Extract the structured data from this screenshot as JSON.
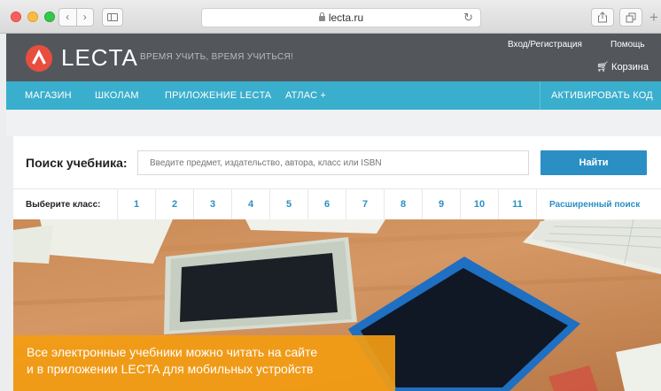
{
  "browser": {
    "url": "lecta.ru",
    "icons": [
      "back-icon",
      "forward-icon",
      "sidebar-icon",
      "lock-icon",
      "reload-icon",
      "share-icon",
      "tabs-icon",
      "new-tab-icon"
    ]
  },
  "header": {
    "logo_text": "LECTA",
    "slogan": "ВРЕМЯ УЧИТЬ, ВРЕМЯ УЧИТЬСЯ!",
    "login": "Вход/Регистрация",
    "help": "Помощь",
    "cart": "Корзина",
    "colors": {
      "header_bg": "#53575c",
      "logo_red": "#e84e3e"
    }
  },
  "nav": {
    "items": [
      "МАГАЗИН",
      "ШКОЛАМ",
      "ПРИЛОЖЕНИЕ LECTA",
      "АТЛАС +"
    ],
    "activate": "АКТИВИРОВАТЬ КОД",
    "color": "#3aaecd"
  },
  "search": {
    "label": "Поиск учебника:",
    "placeholder": "Введите предмет, издательство, автора, класс или ISBN",
    "button": "Найти",
    "class_label": "Выберите класс:",
    "grades": [
      "1",
      "2",
      "3",
      "4",
      "5",
      "6",
      "7",
      "8",
      "9",
      "10",
      "11"
    ],
    "advanced": "Расширенный поиск",
    "accent": "#2b8fc4"
  },
  "hero": {
    "line1": "Все электронные учебники можно читать на сайте",
    "line2": "и в приложении LECTA для мобильных устройств",
    "banner_color": "#f39c12"
  }
}
